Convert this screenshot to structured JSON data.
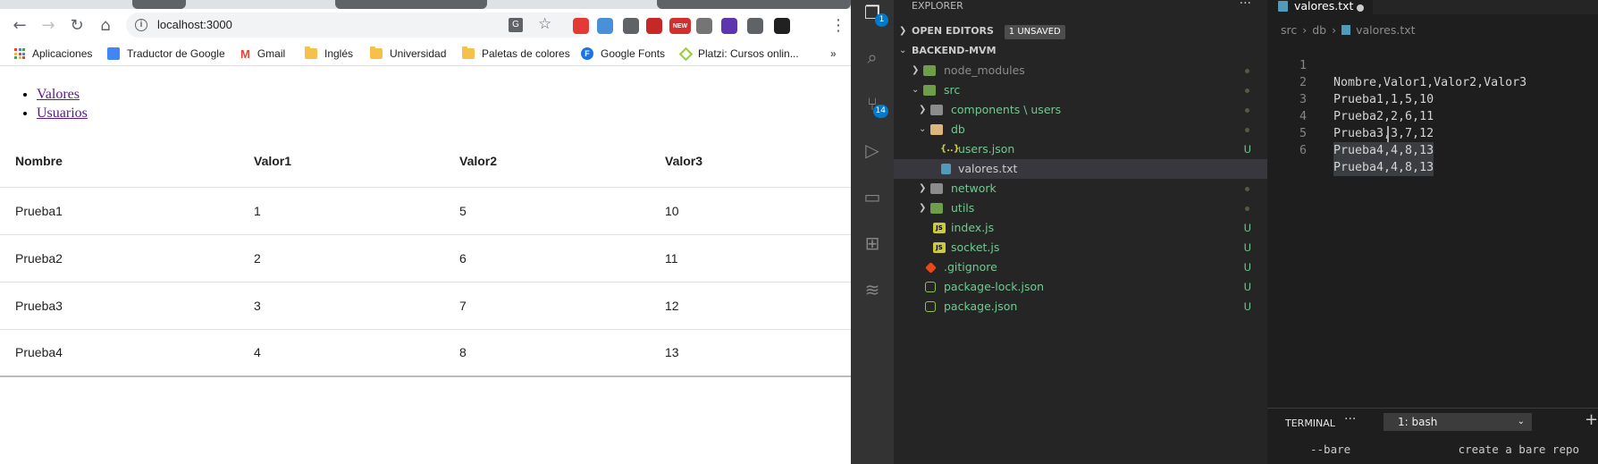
{
  "browser": {
    "url": "localhost:3000",
    "bookmarks": [
      {
        "label": "Aplicaciones",
        "icon": "apps-icon"
      },
      {
        "label": "Traductor de Google",
        "icon": "google-translate-icon"
      },
      {
        "label": "Gmail",
        "icon": "gmail-icon"
      },
      {
        "label": "Inglés",
        "icon": "folder-icon"
      },
      {
        "label": "Universidad",
        "icon": "folder-icon"
      },
      {
        "label": "Paletas de colores",
        "icon": "folder-icon"
      },
      {
        "label": "Google Fonts",
        "icon": "google-fonts-icon"
      },
      {
        "label": "Platzi: Cursos onlin...",
        "icon": "platzi-icon"
      }
    ],
    "extensions": [
      {
        "name": "adblock-icon",
        "color": "#e53935"
      },
      {
        "name": "extension-blue-icon",
        "color": "#4a90d9"
      },
      {
        "name": "eyedropper-icon",
        "color": "#5f6368"
      },
      {
        "name": "extension-red-icon",
        "color": "#c62828"
      },
      {
        "name": "new-badge-icon",
        "color": "#d32f2f",
        "text": "NEW"
      },
      {
        "name": "extension-gray-icon",
        "color": "#757575"
      },
      {
        "name": "extension-purple-icon",
        "color": "#5e35b1"
      },
      {
        "name": "puzzle-icon",
        "color": "#5f6368"
      },
      {
        "name": "profile-icon",
        "color": "#212121"
      }
    ],
    "page": {
      "links": [
        "Valores",
        "Usuarios"
      ],
      "table": {
        "headers": [
          "Nombre",
          "Valor1",
          "Valor2",
          "Valor3"
        ],
        "rows": [
          [
            "Prueba1",
            "1",
            "5",
            "10"
          ],
          [
            "Prueba2",
            "2",
            "6",
            "11"
          ],
          [
            "Prueba3",
            "3",
            "7",
            "12"
          ],
          [
            "Prueba4",
            "4",
            "8",
            "13"
          ]
        ]
      }
    }
  },
  "vscode": {
    "activity_badges": {
      "explorer": "1",
      "scm": "14"
    },
    "explorer": {
      "title": "EXPLORER",
      "open_editors": "OPEN EDITORS",
      "unsaved": "1 UNSAVED",
      "project": "BACKEND-MVM",
      "tree": [
        {
          "label": "node_modules",
          "status": "dot"
        },
        {
          "label": "src",
          "status": "dot"
        },
        {
          "label": "components \\ users",
          "status": "dot"
        },
        {
          "label": "db",
          "status": "dot"
        },
        {
          "label": "users.json",
          "status": "U"
        },
        {
          "label": "valores.txt",
          "status": ""
        },
        {
          "label": "network",
          "status": "dot"
        },
        {
          "label": "utils",
          "status": "dot"
        },
        {
          "label": "index.js",
          "status": "U"
        },
        {
          "label": "socket.js",
          "status": "U"
        },
        {
          "label": ".gitignore",
          "status": "U"
        },
        {
          "label": "package-lock.json",
          "status": "U"
        },
        {
          "label": "package.json",
          "status": "U"
        }
      ]
    },
    "editor": {
      "tab": "valores.txt",
      "breadcrumbs": [
        "src",
        "db",
        "valores.txt"
      ],
      "lines": [
        {
          "n": "1",
          "text": "Nombre,Valor1,Valor2,Valor3"
        },
        {
          "n": "2",
          "text": "Prueba1,1,5,10"
        },
        {
          "n": "3",
          "text": "Prueba2,2,6,11"
        },
        {
          "n": "4",
          "text": "Prueba3,3,7,12"
        },
        {
          "n": "5",
          "text": "Prueba4,4,8,13"
        },
        {
          "n": "6",
          "text": "Prueba4,4,8,13"
        }
      ]
    },
    "terminal": {
      "label": "TERMINAL",
      "selected": "1: bash",
      "output": "--bare                create a bare repo"
    }
  }
}
